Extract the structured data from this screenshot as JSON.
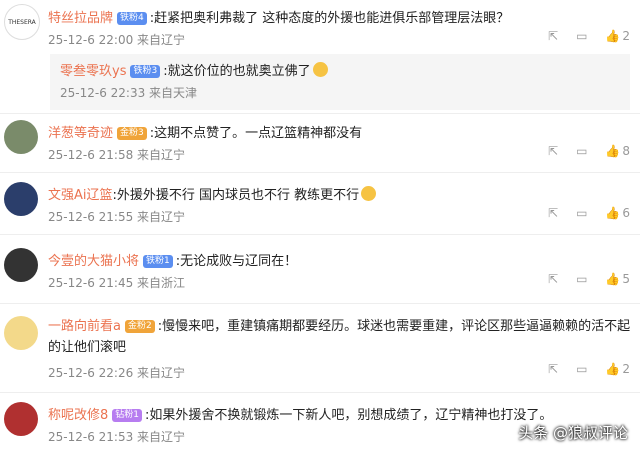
{
  "comments": [
    {
      "name": "特丝拉品牌",
      "badge": "铁粉4",
      "text": ":赶紧把奥利弗裁了 这种态度的外援也能进俱乐部管理层法眼？",
      "time": "25-12-6 22:00 来自辽宁",
      "likes": "2",
      "avatar_text": "THESERA"
    },
    {
      "name": "零叁零玖ys",
      "badge": "铁粉3",
      "text": ":就这价位的也就奥立佛了",
      "time": "25-12-6 22:33 来自天津"
    },
    {
      "name": "洋葱等奇迹",
      "badge": "金粉3",
      "text": ":这期不点赞了。一点辽篮精神都没有",
      "time": "25-12-6 21:58 来自辽宁",
      "likes": "8"
    },
    {
      "name": "文强Ai辽篮",
      "badge": "",
      "text": ":外援外援不行 国内球员也不行 教练更不行",
      "time": "25-12-6 21:55 来自辽宁",
      "likes": "6"
    },
    {
      "name": "今壹的大猫小将",
      "badge": "铁粉1",
      "text": ":无论成败与辽同在！",
      "time": "25-12-6 21:45 来自浙江",
      "likes": "5"
    },
    {
      "name": "一路向前看a",
      "badge": "金粉2",
      "text": ":慢慢来吧，重建镇痛期都要经历。球迷也需要重建，评论区那些逼逼赖赖的活不起的让他们滚吧",
      "time": "25-12-6 22:26 来自辽宁",
      "likes": "2"
    },
    {
      "name": "称呢改修8",
      "badge": "钻粉1",
      "text": ":如果外援舍不换就锻炼一下新人吧，别想成绩了，辽宁精神也打没了。",
      "time": "25-12-6 21:53 来自辽宁"
    }
  ],
  "watermark": "头条 @狼叔评论"
}
